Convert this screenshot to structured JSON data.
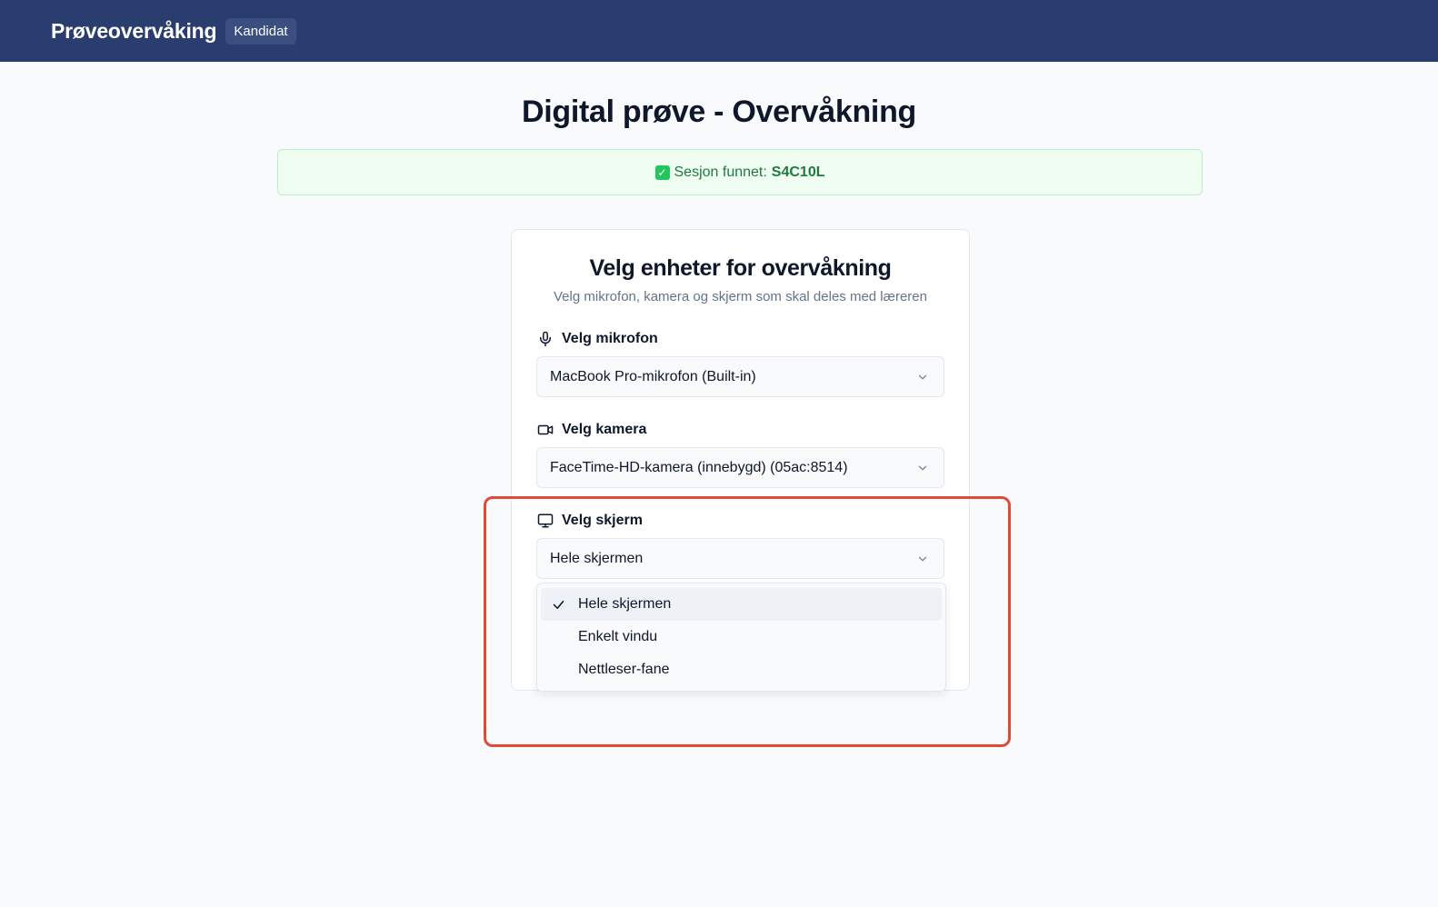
{
  "header": {
    "brand": "Prøveovervåking",
    "role_badge": "Kandidat"
  },
  "page": {
    "title": "Digital prøve - Overvåkning"
  },
  "session_banner": {
    "prefix": "Sesjon funnet:",
    "code": "S4C10L",
    "icon": "check-mark-emoji",
    "color": "#1f7a3d"
  },
  "device_card": {
    "title": "Velg enheter for overvåkning",
    "subtitle": "Velg mikrofon, kamera og skjerm som skal deles med læreren",
    "microphone": {
      "label": "Velg mikrofon",
      "icon": "microphone-icon",
      "value": "MacBook Pro-mikrofon (Built-in)"
    },
    "camera": {
      "label": "Velg kamera",
      "icon": "video-camera-icon",
      "value": "FaceTime-HD-kamera (innebygd) (05ac:8514)"
    },
    "screen": {
      "label": "Velg skjerm",
      "icon": "monitor-icon",
      "value": "Hele skjermen",
      "options": [
        "Hele skjermen",
        "Enkelt vindu",
        "Nettleser-fane"
      ],
      "selected_index": 0
    }
  },
  "colors": {
    "header_bg": "#293d6e",
    "highlight_border": "#e04a3a"
  }
}
